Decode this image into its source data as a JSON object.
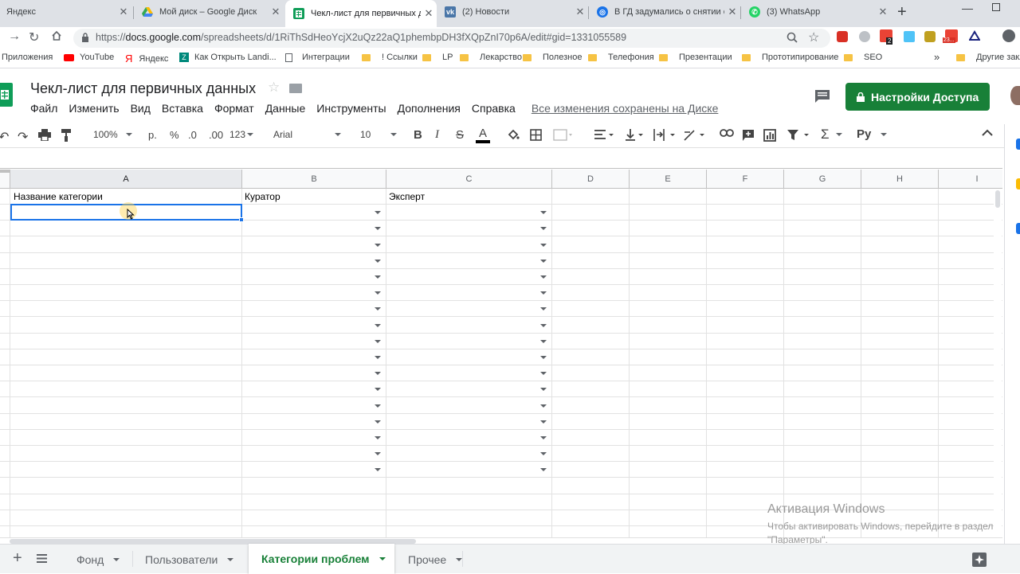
{
  "browser": {
    "tabs": [
      {
        "title": "Яндекс",
        "icon": "yandex-icon",
        "color": "#ff0000",
        "active": false
      },
      {
        "title": "Мой диск – Google Диск",
        "icon": "google-drive-icon",
        "color": "#34a853",
        "active": false
      },
      {
        "title": "Чекл-лист для первичных д",
        "icon": "google-sheets-icon",
        "color": "#0f9d58",
        "active": true
      },
      {
        "title": "(2) Новости",
        "icon": "vk-icon",
        "color": "#4a76a8",
        "active": false
      },
      {
        "title": "В ГД задумались о снятии с",
        "icon": "news-icon",
        "color": "#1a73e8",
        "active": false
      },
      {
        "title": "(3) WhatsApp",
        "icon": "whatsapp-icon",
        "color": "#25d366",
        "active": false
      }
    ],
    "new_tab_label": "+",
    "url_prefix": "https://",
    "url_host": "docs.google.com",
    "url_path": "/spreadsheets/d/1RiThSdHeoYcjX2uQz22aQ1phembpDH3fXQpZnI70p6A/edit#gid=1331055589",
    "extension_badge_1": "2",
    "extension_badge_2": "23...",
    "bookmarks": [
      {
        "label": "Приложения",
        "type": "apps"
      },
      {
        "label": "YouTube",
        "type": "youtube"
      },
      {
        "label": "Яндекс",
        "type": "yandex"
      },
      {
        "label": "Как Открыть Landi...",
        "type": "z"
      },
      {
        "label": "Интеграции",
        "type": "page"
      },
      {
        "label": "! Ссылки",
        "type": "folder"
      },
      {
        "label": "LP",
        "type": "folder"
      },
      {
        "label": "Лекарство",
        "type": "folder"
      },
      {
        "label": "Полезное",
        "type": "folder"
      },
      {
        "label": "Телефония",
        "type": "folder"
      },
      {
        "label": "Презентации",
        "type": "folder"
      },
      {
        "label": "Прототипирование",
        "type": "folder"
      },
      {
        "label": "SEO",
        "type": "folder"
      }
    ],
    "more_bookmarks": "»",
    "other_bookmarks": "Другие закла"
  },
  "doc": {
    "title": "Чекл-лист для первичных данных",
    "menu": [
      "Файл",
      "Изменить",
      "Вид",
      "Вставка",
      "Формат",
      "Данные",
      "Инструменты",
      "Дополнения",
      "Справка"
    ],
    "save_status": "Все изменения сохранены на Диске",
    "share_label": "Настройки Доступа"
  },
  "toolbar": {
    "zoom": "100%",
    "currency": "р.",
    "percent": "%",
    "decrease_decimals": ".0",
    "increase_decimals": ".00",
    "more_formats": "123",
    "font": "Arial",
    "font_size": "10",
    "bold": "B",
    "italic": "I",
    "strikethrough": "S",
    "text_color": "A",
    "input_tools": "Ру"
  },
  "sheet": {
    "columns": [
      "A",
      "B",
      "C",
      "D",
      "E",
      "F",
      "G",
      "H",
      "I"
    ],
    "headers": {
      "a1": "Название категории",
      "b1": "Куратор",
      "c1": "Эксперт"
    },
    "dropdown_rows": 17
  },
  "bottom": {
    "add_sheet": "+",
    "sheets": [
      {
        "label": "Фонд",
        "active": false
      },
      {
        "label": "Пользователи",
        "active": false
      },
      {
        "label": "Категории проблем",
        "active": true
      },
      {
        "label": "Прочее",
        "active": false
      }
    ]
  },
  "watermark": {
    "title": "Активация Windows",
    "line1": "Чтобы активировать Windows, перейдите в раздел",
    "line2": "\"Параметры\"."
  },
  "colors": {
    "sheets_green": "#0f9d58",
    "share_green": "#188038",
    "selection_blue": "#1a73e8",
    "active_sheet_tab": "#188038"
  }
}
